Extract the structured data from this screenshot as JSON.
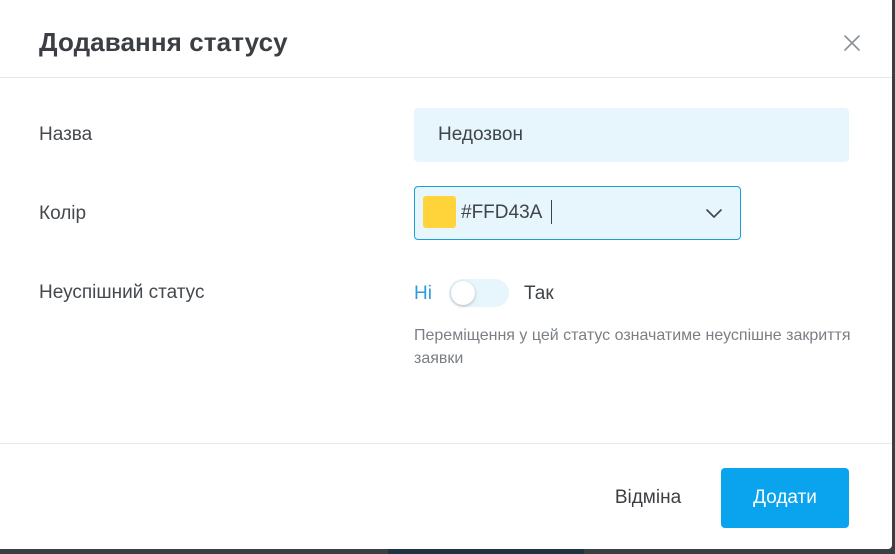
{
  "dialog": {
    "title": "Додавання статусу",
    "close_icon": "close-icon"
  },
  "form": {
    "name": {
      "label": "Назва",
      "value": "Недозвон"
    },
    "color": {
      "label": "Колір",
      "value": "#FFD43A",
      "swatch_color": "#FFD43A",
      "dropdown_icon": "chevron-down-icon"
    },
    "failed_status": {
      "label": "Неуспішний статус",
      "off_label": "Ні",
      "on_label": "Так",
      "enabled": false,
      "hint": "Переміщення у цей статус означатиме неуспішне закриття заявки"
    }
  },
  "footer": {
    "cancel_label": "Відміна",
    "submit_label": "Додати"
  },
  "colors": {
    "accent": "#0AA3EE",
    "input_background": "#E7F5FD",
    "toggle_off_label": "#2B9DE0"
  }
}
